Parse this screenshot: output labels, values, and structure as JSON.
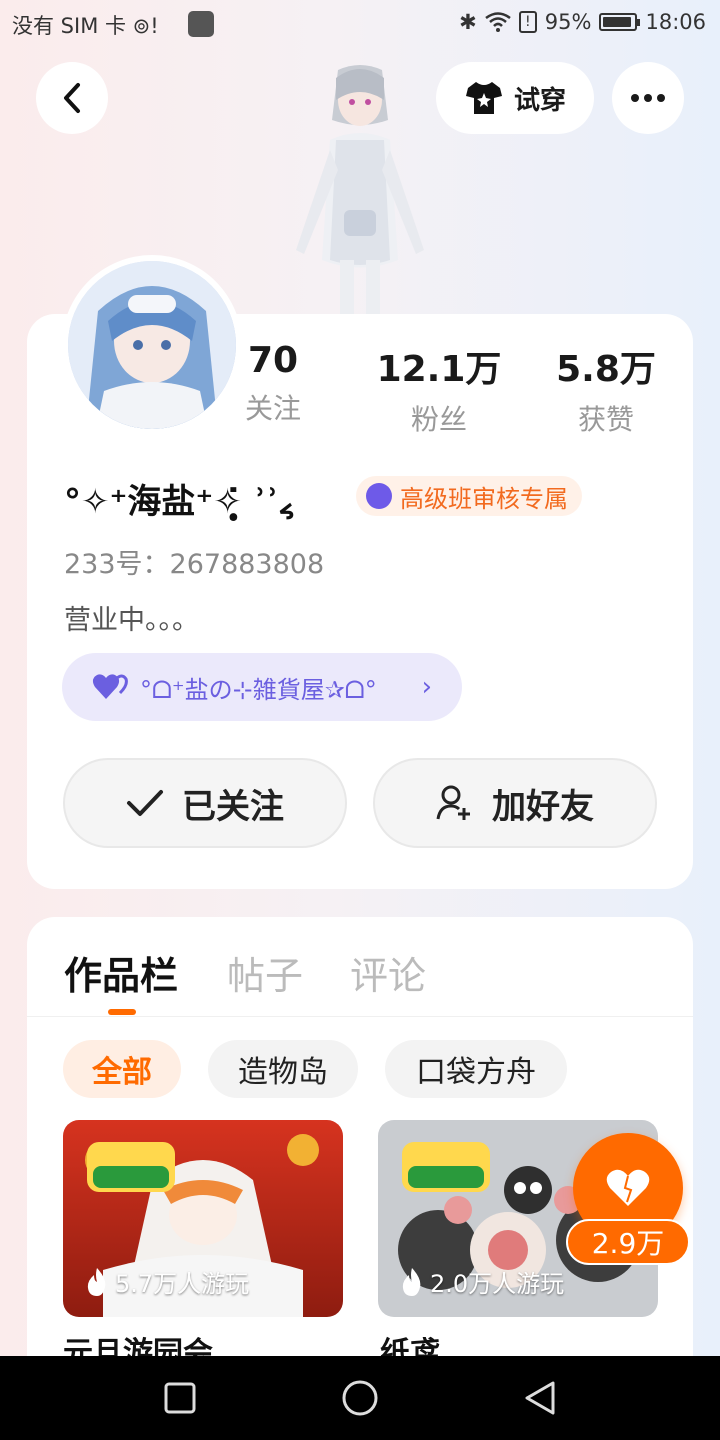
{
  "status_bar": {
    "carrier": "没有 SIM 卡 ⊚!",
    "battery": "95%",
    "time": "18:06"
  },
  "header": {
    "tryon_label": "试穿"
  },
  "stats": [
    {
      "num": "70",
      "label": "关注"
    },
    {
      "num": "12.1万",
      "label": "粉丝"
    },
    {
      "num": "5.8万",
      "label": "获赞"
    }
  ],
  "profile": {
    "username": "°✧⁺海盐⁺✧̣̥̇ ʾʾ៹",
    "badge": "高级班审核专属",
    "uid": "233号：267883808",
    "bio": "营业中。。。",
    "group": "°ᗝ⁺盐の⊹雑貨屋✰ᗝ°",
    "follow_label": "已关注",
    "add_friend_label": "加好友"
  },
  "tabs": [
    {
      "label": "作品栏"
    },
    {
      "label": "帖子"
    },
    {
      "label": "评论"
    }
  ],
  "filters": [
    {
      "label": "全部"
    },
    {
      "label": "造物岛"
    },
    {
      "label": "口袋方舟"
    }
  ],
  "works": [
    {
      "plays": "5.7万人游玩",
      "title": "元旦游园会"
    },
    {
      "plays": "2.0万人游玩",
      "title": "纸鸢"
    }
  ],
  "like": {
    "count": "2.9万",
    "color": "#ff6a00"
  },
  "colors": {
    "accent": "#ff6a00",
    "badge_text": "#f26a1f",
    "group_text": "#6b5fe0"
  }
}
